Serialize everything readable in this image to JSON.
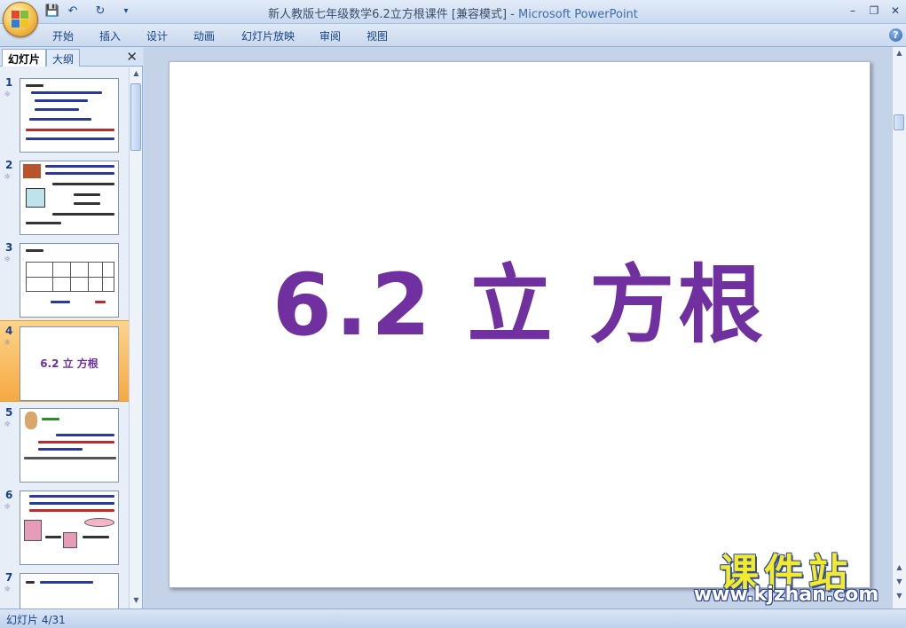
{
  "window": {
    "title_doc": "新人教版七年级数学6.2立方根课件 [兼容模式]",
    "title_sep": " - ",
    "title_app": "Microsoft PowerPoint",
    "min_glyph": "–",
    "restore_glyph": "❐",
    "close_glyph": "✕"
  },
  "quick_access": {
    "save_glyph": "💾",
    "undo_glyph": "↶",
    "redo_glyph": "↻",
    "more_glyph": "▾"
  },
  "ribbon": {
    "tabs": [
      "开始",
      "插入",
      "设计",
      "动画",
      "幻灯片放映",
      "审阅",
      "视图"
    ],
    "help_glyph": "?"
  },
  "panel": {
    "tab_slides": "幻灯片",
    "tab_outline": "大纲",
    "close_glyph": "✕",
    "thumbnails": [
      {
        "num": "1"
      },
      {
        "num": "2"
      },
      {
        "num": "3"
      },
      {
        "num": "4",
        "title": "6.2  立 方根",
        "selected": true
      },
      {
        "num": "5"
      },
      {
        "num": "6"
      },
      {
        "num": "7"
      }
    ],
    "anim_glyph": "☼"
  },
  "slide": {
    "title": "6.2  立 方根"
  },
  "watermark": {
    "big": "课件站",
    "url": "www.kjzhan.com"
  },
  "status": {
    "slide_indicator": "幻灯片 4/31"
  },
  "colors": {
    "title_purple": "#7030a0",
    "ribbon_text": "#15428b",
    "selected_thumb": "#f6a843"
  }
}
